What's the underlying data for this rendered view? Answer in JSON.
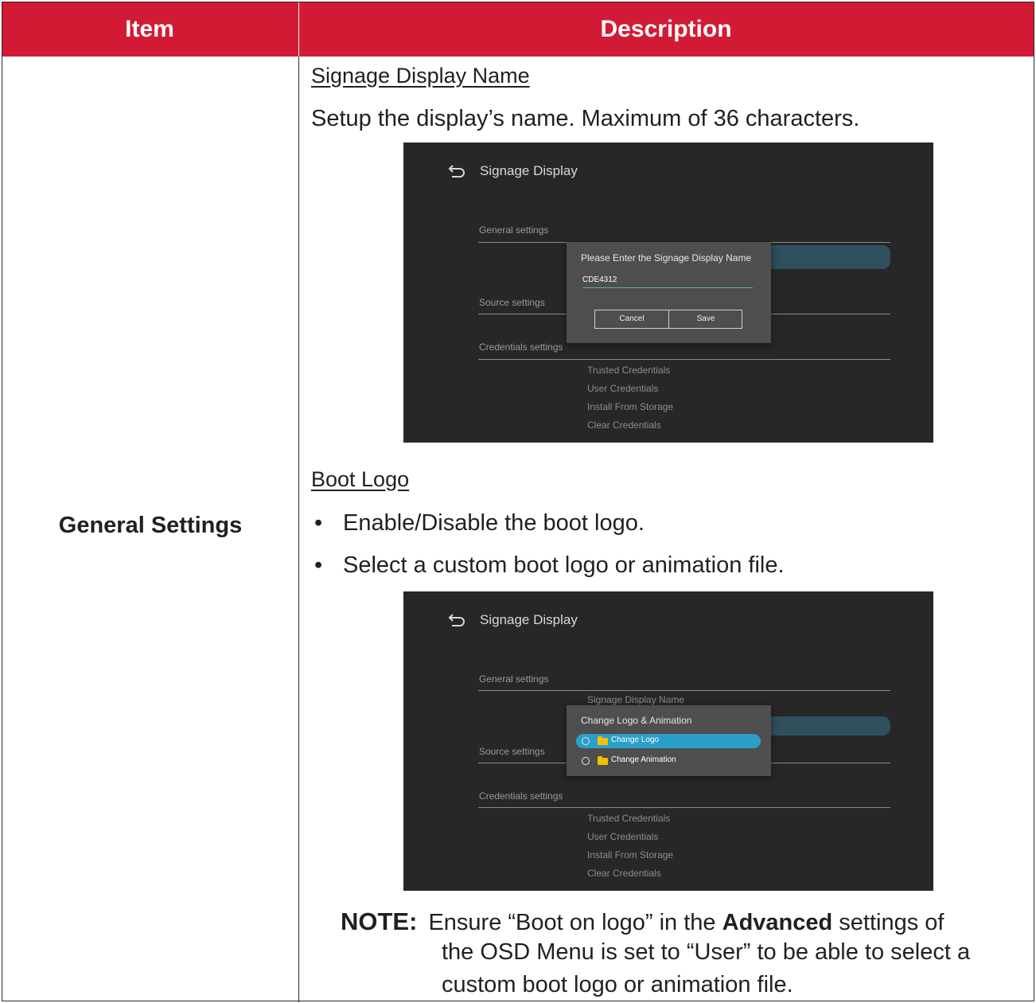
{
  "header": {
    "item": "Item",
    "description": "Description"
  },
  "item_label": "General Settings",
  "section1": {
    "title": "Signage Display Name",
    "text": "Setup the display’s name. Maximum of 36 characters."
  },
  "section2": {
    "title": "Boot Logo",
    "bullets": [
      "Enable/Disable the boot logo.",
      "Select a custom boot logo or animation file."
    ]
  },
  "note": {
    "label": "NOTE:",
    "part1": "Ensure “Boot on logo” in the",
    "bold": "Advanced",
    "part2": "settings of",
    "line2": "the OSD Menu is set to “User” to be able to select a",
    "line3": "custom boot logo or animation file."
  },
  "screenshot1": {
    "title": "Signage Display",
    "categories": [
      "General settings",
      "Source settings",
      "Credentials settings"
    ],
    "items": [
      "Trusted Credentials",
      "User Credentials",
      "Install From Storage",
      "Clear Credentials"
    ],
    "dialog": {
      "title": "Please Enter the Signage Display Name",
      "value": "CDE4312",
      "cancel": "Cancel",
      "save": "Save"
    }
  },
  "screenshot2": {
    "title": "Signage Display",
    "categories": [
      "General settings",
      "Source settings",
      "Credentials settings"
    ],
    "partial_item": "Signage Display Name",
    "items": [
      "Trusted Credentials",
      "User Credentials",
      "Install From Storage",
      "Clear Credentials"
    ],
    "dialog": {
      "title": "Change Logo & Animation",
      "options": [
        "Change Logo",
        "Change Animation"
      ],
      "selected": 0
    }
  },
  "colors": {
    "header_bg": "#d31a35",
    "screen_bg": "#272727",
    "dialog_bg": "#4e4e4e",
    "selected_option": "#2aa0c8",
    "folder": "#f2c200"
  }
}
